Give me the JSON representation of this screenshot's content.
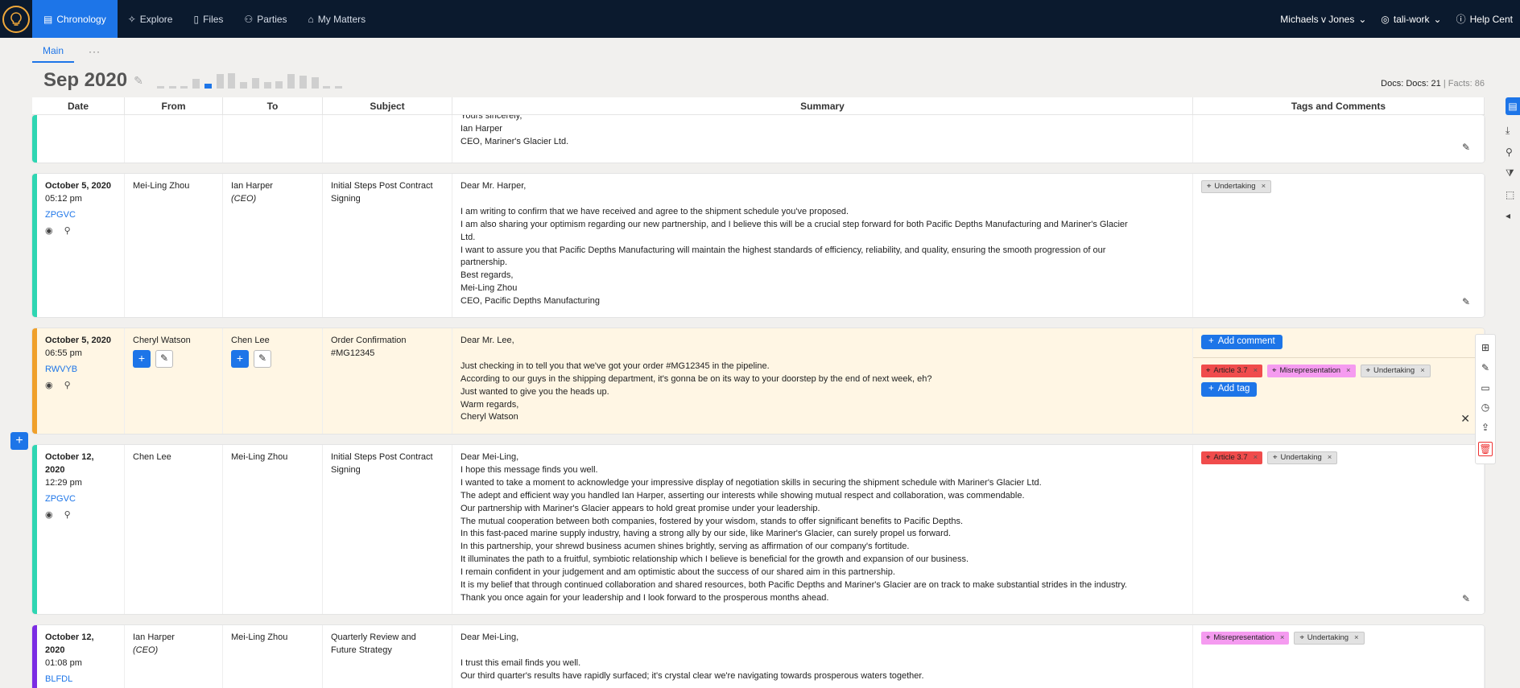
{
  "nav": {
    "items": [
      {
        "label": "Chronology",
        "active": true,
        "icon": "calendar-icon"
      },
      {
        "label": "Explore",
        "icon": "sparkle-icon"
      },
      {
        "label": "Files",
        "icon": "file-icon"
      },
      {
        "label": "Parties",
        "icon": "people-icon"
      },
      {
        "label": "My Matters",
        "icon": "briefcase-icon"
      }
    ],
    "matter": "Michaels v Jones",
    "workspace": "tali-work",
    "help": "Help Cent"
  },
  "subtabs": {
    "main": "Main",
    "more": "···"
  },
  "header": {
    "title": "Sep 2020",
    "docs_label": "Docs: Docs: 21",
    "facts_label": "Facts: 86",
    "histogram": [
      0.1,
      0.1,
      0.1,
      0.45,
      0.25,
      0.7,
      0.75,
      0.3,
      0.5,
      0.3,
      0.35,
      0.7,
      0.6,
      0.55,
      0.1,
      0.1
    ],
    "histogram_active_index": 4
  },
  "columns": {
    "date": "Date",
    "from": "From",
    "to": "To",
    "subject": "Subject",
    "summary": "Summary",
    "tags": "Tags and Comments"
  },
  "rows": [
    {
      "summary": [
        "Yours sincerely,",
        "Ian Harper",
        "CEO, Mariner's Glacier Ltd."
      ]
    },
    {
      "date": "October 5, 2020",
      "time": "05:12 pm",
      "doc_id": "ZPGVC",
      "from": "Mei-Ling Zhou",
      "to": "Ian Harper",
      "to_role": "(CEO)",
      "subject": "Initial Steps Post Contract Signing",
      "summary": [
        "Dear Mr. Harper,",
        "",
        "I am writing to confirm that we have received and agree to the shipment schedule you've proposed.",
        "I am also sharing your optimism regarding our new partnership, and I believe this will be a crucial step forward for both Pacific Depths Manufacturing and Mariner's Glacier",
        "Ltd.",
        "I want to assure you that Pacific Depths Manufacturing will maintain the highest standards of efficiency, reliability, and quality, ensuring the smooth progression of our",
        "partnership.",
        "Best regards,",
        "Mei-Ling Zhou",
        "CEO, Pacific Depths Manufacturing"
      ],
      "tags": [
        {
          "label": "Undertaking",
          "color": "grey"
        }
      ]
    },
    {
      "date": "October 5, 2020",
      "time": "06:55 pm",
      "doc_id": "RWVYB",
      "from": "Cheryl Watson",
      "to": "Chen Lee",
      "subject": "Order Confirmation #MG12345",
      "summary": [
        "Dear Mr. Lee,",
        "",
        "Just checking in to tell you that we've got your order #MG12345 in the pipeline.",
        "According to our guys in the shipping department, it's gonna be on its way to your doorstep by the end of next week, eh?",
        "Just wanted to give you the heads up.",
        "Warm regards,",
        "Cheryl Watson"
      ],
      "add_comment": "Add comment",
      "add_tag": "Add tag",
      "tags": [
        {
          "label": "Article 3.7",
          "color": "red"
        },
        {
          "label": "Misrepresentation",
          "color": "pink"
        },
        {
          "label": "Undertaking",
          "color": "grey"
        }
      ]
    },
    {
      "date": "October 12, 2020",
      "time": "12:29 pm",
      "doc_id": "ZPGVC",
      "from": "Chen Lee",
      "to": "Mei-Ling Zhou",
      "subject": "Initial Steps Post Contract Signing",
      "summary": [
        "Dear Mei-Ling,",
        "I hope this message finds you well.",
        "I wanted to take a moment to acknowledge your impressive display of negotiation skills in securing the shipment schedule with Mariner's Glacier Ltd.",
        "The adept and efficient way you handled Ian Harper, asserting our interests while showing mutual respect and collaboration, was commendable.",
        "Our partnership with Mariner's Glacier appears to hold great promise under your leadership.",
        "The mutual cooperation between both companies, fostered by your wisdom, stands to offer significant benefits to Pacific Depths.",
        "In this fast-paced marine supply industry, having a strong ally by our side, like Mariner's Glacier, can surely propel us forward.",
        "In this partnership, your shrewd business acumen shines brightly, serving as affirmation of our company's fortitude.",
        "It illuminates the path to a fruitful, symbiotic relationship which I believe is beneficial for the growth and expansion of our business.",
        "I remain confident in your judgement and am optimistic about the success of our shared aim in this partnership.",
        "It is my belief that through continued collaboration and shared resources, both Pacific Depths and Mariner's Glacier are on track to make substantial strides in the industry.",
        "Thank you once again for your leadership and I look forward to the prosperous months ahead."
      ],
      "tags": [
        {
          "label": "Article 3.7",
          "color": "red"
        },
        {
          "label": "Undertaking",
          "color": "grey"
        }
      ]
    },
    {
      "date": "October 12, 2020",
      "time": "01:08 pm",
      "doc_id": "BLFDL",
      "from": "Ian Harper",
      "from_role": "(CEO)",
      "to": "Mei-Ling Zhou",
      "subject": "Quarterly Review and Future Strategy",
      "summary": [
        "Dear Mei-Ling,",
        "",
        "I trust this email finds you well.",
        "Our third quarter's results have rapidly surfaced; it's crystal clear we're navigating towards prosperous waters together."
      ],
      "tags": [
        {
          "label": "Misrepresentation",
          "color": "pink"
        },
        {
          "label": "Undertaking",
          "color": "grey"
        }
      ]
    }
  ]
}
